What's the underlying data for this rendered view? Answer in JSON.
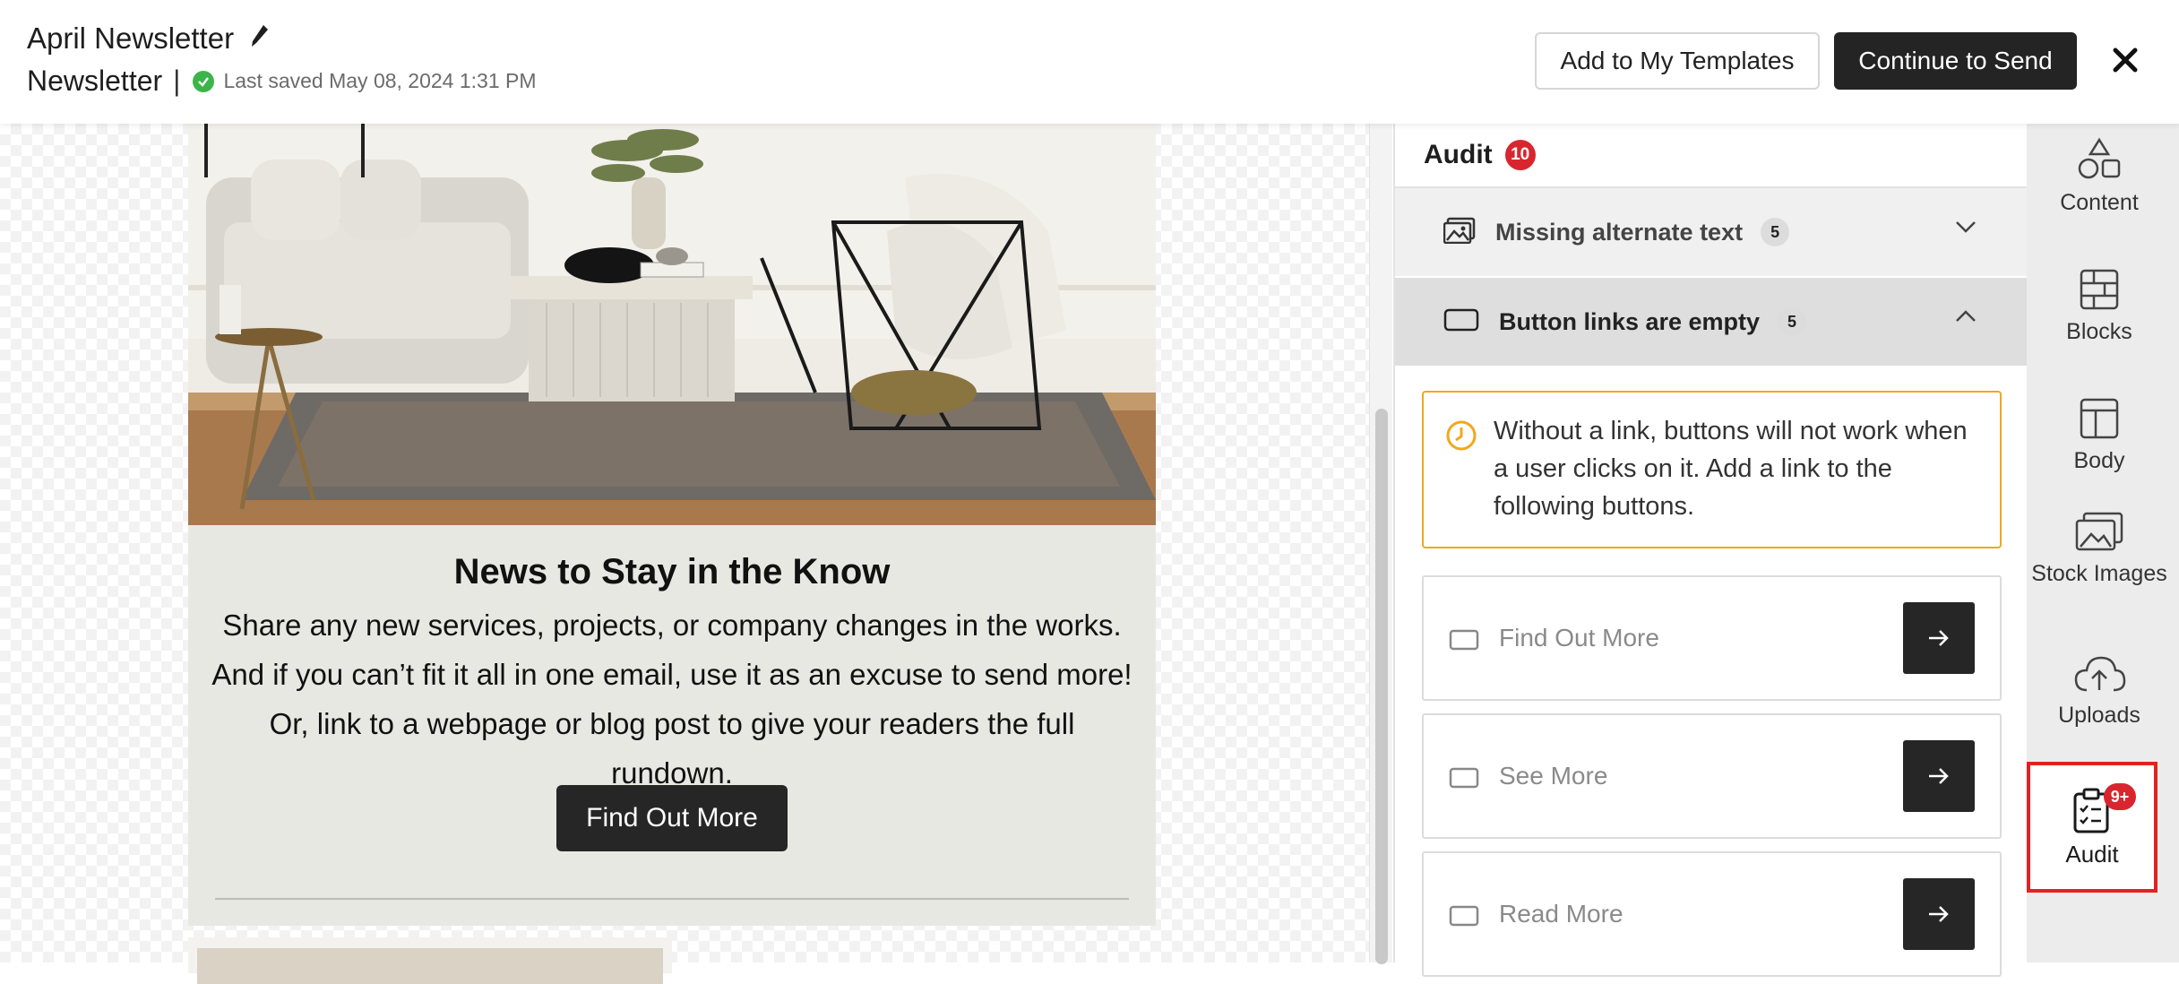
{
  "header": {
    "title": "April Newsletter",
    "doc_type": "Newsletter",
    "separator": "|",
    "saved_text": "Last saved May 08, 2024 1:31 PM",
    "add_templates_label": "Add to My Templates",
    "continue_label": "Continue to Send"
  },
  "email": {
    "headline": "News to Stay in the Know",
    "body": "Share any new services, projects, or company changes in the works. And if you can’t fit it all in one email, use it as an excuse to send more! Or, link to a webpage or blog post to give your readers the full rundown.",
    "button_label": "Find Out More"
  },
  "audit": {
    "title": "Audit",
    "count": "10",
    "sections": [
      {
        "label": "Missing alternate text",
        "count": "5",
        "icon": "image-icon"
      },
      {
        "label": "Button links are empty",
        "count": "5",
        "icon": "button-icon"
      }
    ],
    "warning": "Without a link, buttons will not work when a user clicks on it. Add a link to the following buttons.",
    "buttons": [
      {
        "label": "Find Out More"
      },
      {
        "label": "See More"
      },
      {
        "label": "Read More"
      }
    ]
  },
  "rail": {
    "items": [
      {
        "label": "Content",
        "icon": "shapes-icon"
      },
      {
        "label": "Blocks",
        "icon": "blocks-icon"
      },
      {
        "label": "Body",
        "icon": "layout-icon"
      },
      {
        "label": "Stock Images",
        "icon": "images-icon"
      },
      {
        "label": "Uploads",
        "icon": "cloud-upload-icon"
      }
    ],
    "active": {
      "label": "Audit",
      "badge": "9+",
      "icon": "clipboard-check-icon"
    }
  },
  "colors": {
    "accent_dark": "#262626",
    "alert_red": "#d9262e",
    "warning_orange": "#f0a81e",
    "saved_green": "#3bb54a"
  }
}
